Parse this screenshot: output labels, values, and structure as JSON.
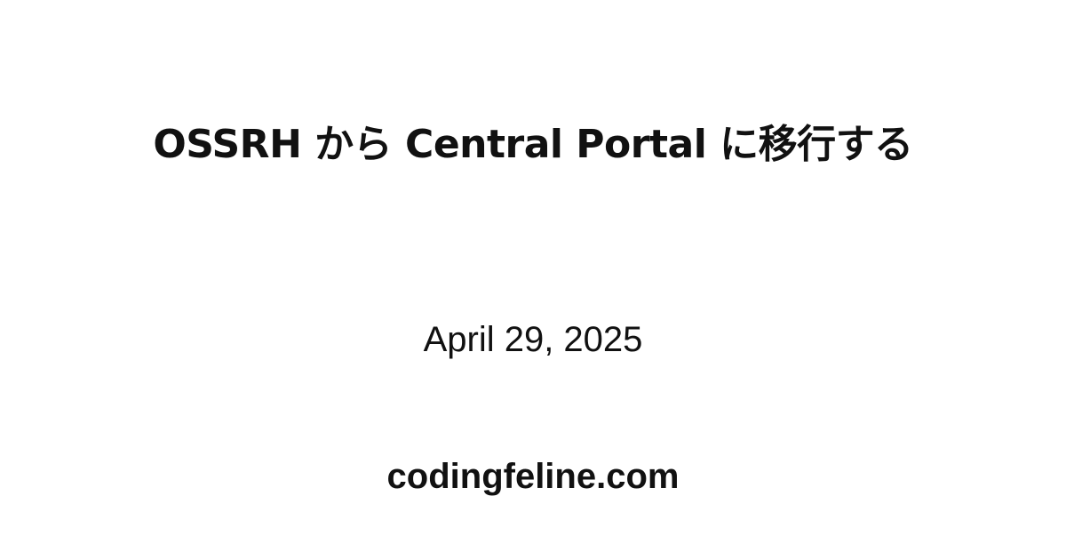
{
  "card": {
    "title": "OSSRH から Central Portal に移行する",
    "date": "April 29, 2025",
    "site": "codingfeline.com"
  }
}
